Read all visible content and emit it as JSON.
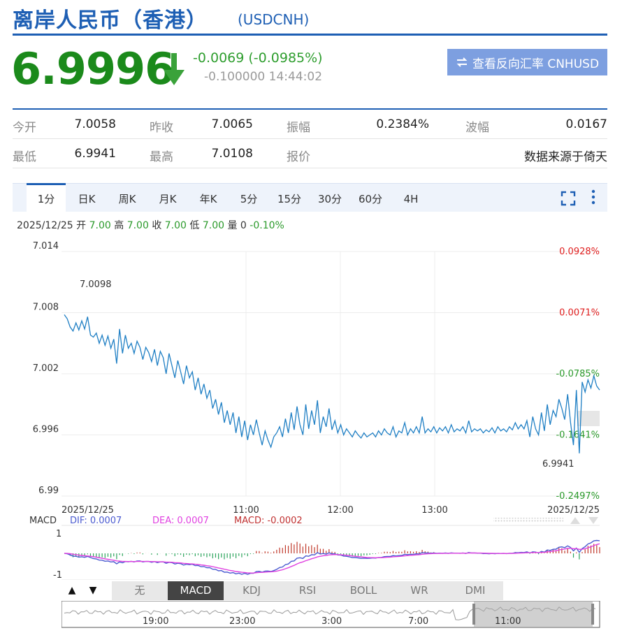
{
  "header": {
    "title": "离岸人民币（香港）",
    "symbol": "(USDCNH)"
  },
  "quote": {
    "price": "6.9996",
    "change": "-0.0069 (-0.0985%)",
    "prev_info": "-0.100000 14:44:02",
    "reverse_button": "查看反向汇率 CNHUSD",
    "colors": {
      "down": "#1b8a1b",
      "accent": "#1e5fb4",
      "up": "#e02020"
    }
  },
  "stats": {
    "row1": [
      {
        "label": "今开",
        "value": "7.0058"
      },
      {
        "label": "昨收",
        "value": "7.0065"
      },
      {
        "label": "振幅",
        "value": "0.2384%"
      },
      {
        "label": "波幅",
        "value": "0.0167"
      }
    ],
    "row2": [
      {
        "label": "最低",
        "value": "6.9941"
      },
      {
        "label": "最高",
        "value": "7.0108"
      },
      {
        "label": "报价",
        "value": ""
      },
      {
        "label": "",
        "value": "数据来源于倚天"
      }
    ]
  },
  "tabs": [
    "1分",
    "日K",
    "周K",
    "月K",
    "年K",
    "5分",
    "15分",
    "30分",
    "60分",
    "4H"
  ],
  "ohlc": {
    "date": "2025/12/25",
    "open_label": "开",
    "open": "7.00",
    "high_label": "高",
    "high": "7.00",
    "close_label": "收",
    "close": "7.00",
    "low_label": "低",
    "low": "7.00",
    "vol_label": "量",
    "vol": "0",
    "pct": "-0.10%"
  },
  "macd": {
    "label": "MACD",
    "dif": "DIF: 0.0007",
    "dea": "DEA: 0.0007",
    "macd": "MACD: -0.0002",
    "ymax": "1",
    "ymin": "-1"
  },
  "indicators": [
    "无",
    "MACD",
    "KDJ",
    "RSI",
    "BOLL",
    "WR",
    "DMI"
  ],
  "navigator": {
    "labels": [
      "19:00",
      "23:00",
      "3:00",
      "7:00",
      "11:00"
    ]
  },
  "chart_data": {
    "type": "line",
    "yticks": [
      "7.014",
      "7.008",
      "7.002",
      "6.996",
      "6.99"
    ],
    "yticks_values": [
      7.014,
      7.008,
      7.002,
      6.996,
      6.99
    ],
    "pct_ticks": [
      "0.0928%",
      "0.0071%",
      "-0.0785%",
      "-0.1641%",
      "-0.2497%"
    ],
    "xticks": [
      "2025/12/25",
      "11:00",
      "12:00",
      "13:00",
      "2025/12/25"
    ],
    "ylim": [
      6.99,
      7.014
    ],
    "high_label": "7.0098",
    "low_label": "6.9941",
    "series": [
      {
        "values": [
          7.0078,
          7.0074,
          7.0066,
          7.0062,
          7.007,
          7.0063,
          7.0072,
          7.0064,
          7.0076,
          7.0058,
          7.0056,
          7.006,
          7.005,
          7.0058,
          7.0048,
          7.0057,
          7.0045,
          7.0054,
          7.003,
          7.0064,
          7.004,
          7.0058,
          7.0045,
          7.005,
          7.004,
          7.0052,
          7.0046,
          7.0034,
          7.0046,
          7.0041,
          7.0032,
          7.0044,
          7.0028,
          7.0042,
          7.0036,
          7.002,
          7.004,
          7.0028,
          7.0016,
          7.0033,
          7.0022,
          7.001,
          7.0028,
          7.0016,
          7.0022,
          7.0004,
          7.0016,
          7.0,
          7.001,
          6.9996,
          7.0004,
          6.9986,
          6.9995,
          6.998,
          6.9992,
          6.9972,
          6.9984,
          6.997,
          6.9982,
          6.9962,
          6.9978,
          6.9958,
          6.9974,
          6.9955,
          6.997,
          6.996,
          6.9975,
          6.9962,
          6.995,
          6.9964,
          6.9955,
          6.9948,
          6.9958,
          6.9962,
          6.9968,
          6.9958,
          6.9976,
          6.9962,
          6.9982,
          6.9965,
          6.9988,
          6.997,
          6.996,
          6.999,
          6.9966,
          6.9984,
          6.997,
          6.9994,
          6.9962,
          6.9978,
          6.9968,
          6.9986,
          6.9965,
          6.9974,
          6.9962,
          6.997,
          6.996,
          6.9966,
          6.9962,
          6.9958,
          6.9964,
          6.996,
          6.9957,
          6.9962,
          6.9958,
          6.996,
          6.9962,
          6.9958,
          6.9964,
          6.996,
          6.9966,
          6.9962,
          6.996,
          6.9968,
          6.9958,
          6.9964,
          6.9962,
          6.9972,
          6.996,
          6.9966,
          6.9962,
          6.9968,
          6.9962,
          6.9978,
          6.9962,
          6.9966,
          6.9963,
          6.9968,
          6.9962,
          6.9967,
          6.9964,
          6.9968,
          6.9962,
          6.997,
          6.9963,
          6.9966,
          6.9964,
          6.9968,
          6.9962,
          6.9974,
          6.9963,
          6.9966,
          6.9964,
          6.9966,
          6.9962,
          6.9965,
          6.9963,
          6.9967,
          6.9962,
          6.9968,
          6.9964,
          6.9966,
          6.9963,
          6.9968,
          6.9965,
          6.9972,
          6.9966,
          6.997,
          6.9966,
          6.9974,
          6.9958,
          6.9978,
          6.9966,
          6.996,
          6.9982,
          6.9964,
          6.999,
          6.997,
          6.9984,
          6.9978,
          6.9995,
          6.9986,
          6.9975,
          7.0,
          6.9972,
          6.995,
          7.0004,
          6.9942,
          7.0012,
          7.0002,
          7.0014,
          7.0006,
          7.0018,
          7.0008,
          7.0004
        ]
      }
    ]
  }
}
